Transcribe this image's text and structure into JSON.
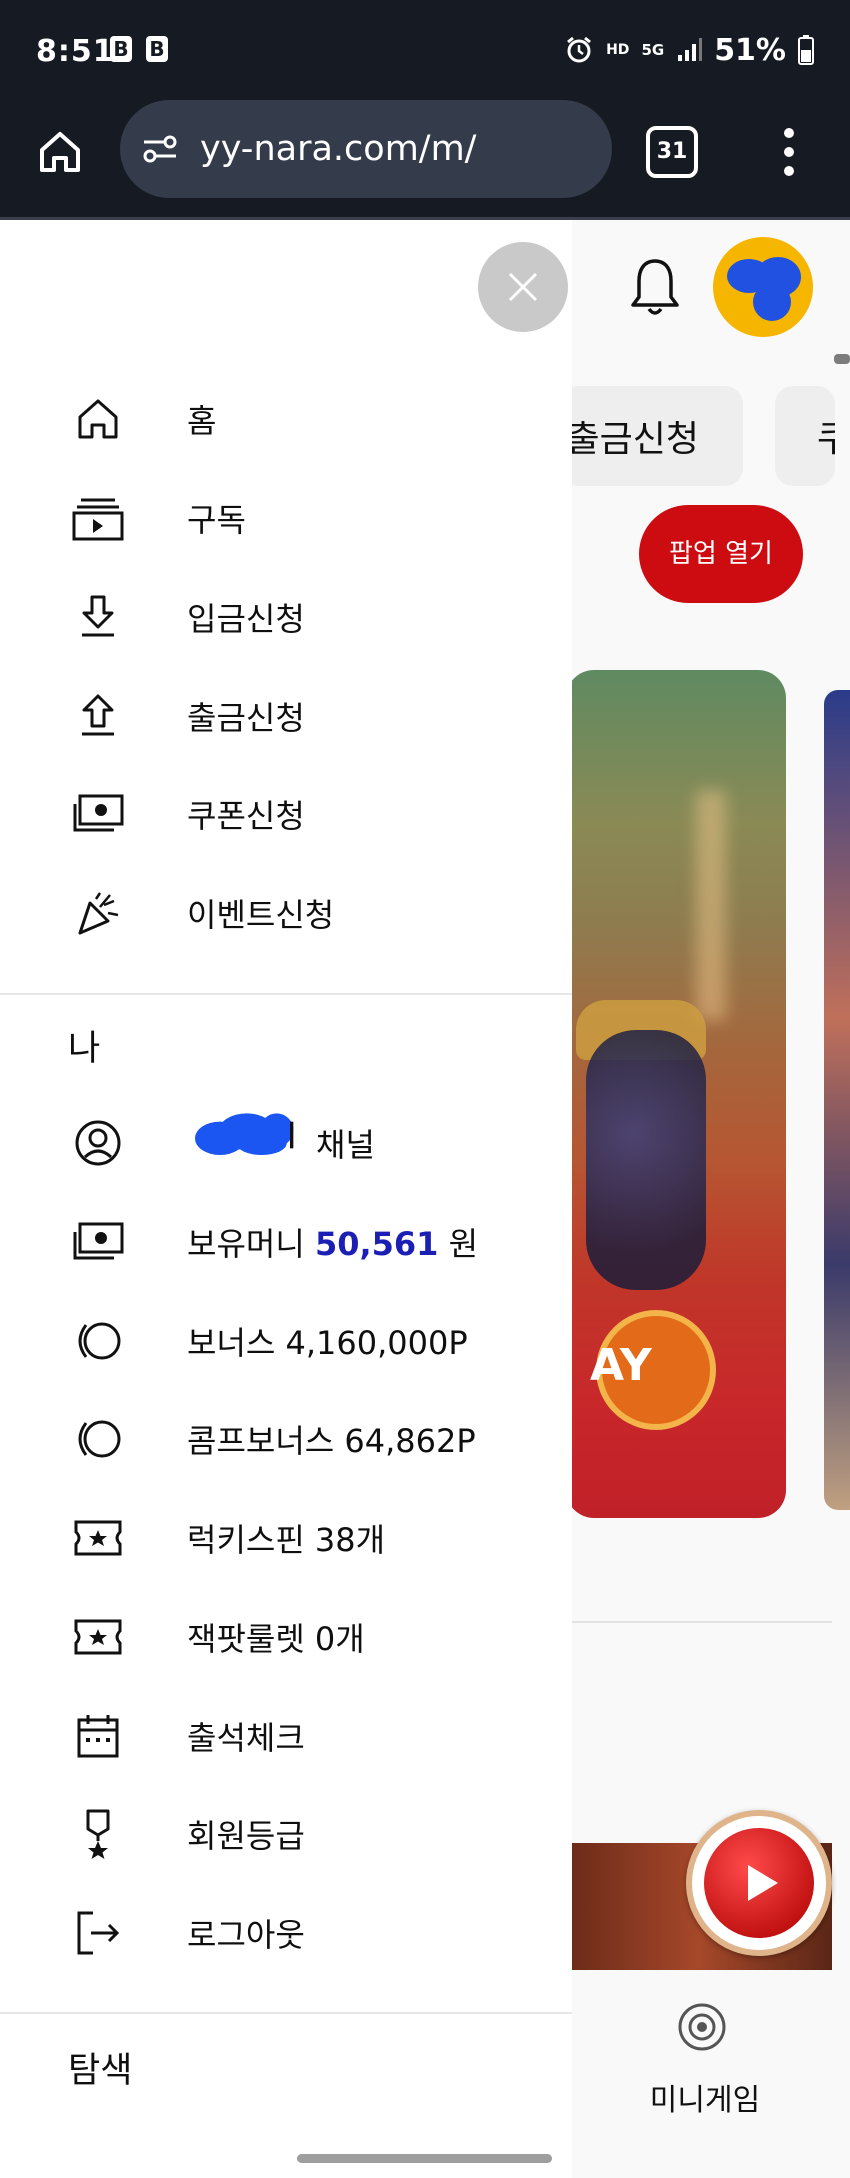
{
  "status_bar": {
    "time": "8:51",
    "badge_1": "B",
    "badge_2": "B",
    "hd_label": "HD",
    "network": "5G",
    "battery": "51%"
  },
  "browser": {
    "url": "yy-nara.com/m/",
    "tab_count": "31"
  },
  "page": {
    "chip_1": "출금신청",
    "chip_2": "쿠",
    "popup_button": "팝업 열기",
    "banner_text": "AY",
    "minigame_label": "미니게임",
    "accent_red": "#cc0c10"
  },
  "drawer": {
    "nav_items": [
      {
        "label": "홈",
        "icon": "home-icon"
      },
      {
        "label": "구독",
        "icon": "subscriptions-icon"
      },
      {
        "label": "입금신청",
        "icon": "download-icon"
      },
      {
        "label": "출금신청",
        "icon": "upload-icon"
      },
      {
        "label": "쿠폰신청",
        "icon": "cash-icon"
      },
      {
        "label": "이벤트신청",
        "icon": "party-popper-icon"
      }
    ],
    "me_section": {
      "title": "나",
      "channel_suffix": "채널",
      "money_label": "보유머니",
      "money_value": "50,561",
      "money_unit": "원",
      "money_color": "#1b1fb4",
      "items": [
        {
          "label": "보너스 4,160,000P",
          "icon": "coin-stack-icon"
        },
        {
          "label": "콤프보너스 64,862P",
          "icon": "coin-stack-icon"
        },
        {
          "label": "럭키스핀 38개",
          "icon": "ticket-icon"
        },
        {
          "label": "잭팟룰렛 0개",
          "icon": "ticket-icon"
        },
        {
          "label": "출석체크",
          "icon": "calendar-icon"
        },
        {
          "label": "회원등급",
          "icon": "medal-icon"
        },
        {
          "label": "로그아웃",
          "icon": "logout-icon"
        }
      ]
    },
    "explore_title": "탐색"
  }
}
